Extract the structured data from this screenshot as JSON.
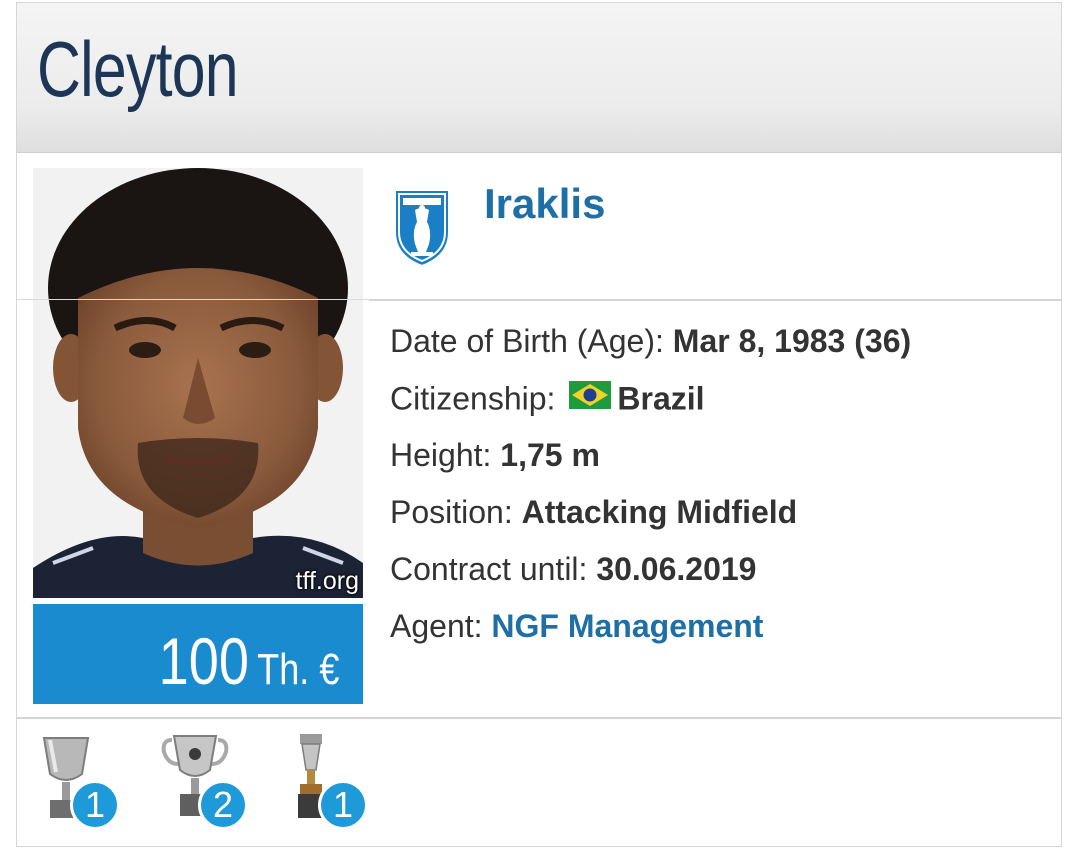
{
  "header": {
    "player_name": "Cleyton"
  },
  "photo": {
    "credit": "tff.org"
  },
  "market_value": {
    "amount": "100",
    "unit": "Th. €"
  },
  "club": {
    "name": "Iraklis",
    "logo_icon": "iraklis-crest-icon"
  },
  "facts": [
    {
      "label": "Date of Birth (Age):",
      "value": "Mar 8, 1983 (36)"
    },
    {
      "label": "Citizenship:",
      "value": "Brazil",
      "flag_icon": "brazil-flag-icon"
    },
    {
      "label": "Height:",
      "value": "1,75 m"
    },
    {
      "label": "Position:",
      "value": "Attacking Midfield"
    },
    {
      "label": "Contract until:",
      "value": "30.06.2019"
    },
    {
      "label": "Agent:",
      "value": "NGF Management",
      "is_link": true
    }
  ],
  "trophies": [
    {
      "icon": "silver-trophy-icon",
      "count": "1"
    },
    {
      "icon": "cup-trophy-icon",
      "count": "2"
    },
    {
      "icon": "tall-trophy-icon",
      "count": "1"
    }
  ],
  "colors": {
    "accent": "#1b8bd0",
    "link": "#1d6fa5",
    "title": "#1d3557",
    "badge": "#1e9ad9"
  }
}
